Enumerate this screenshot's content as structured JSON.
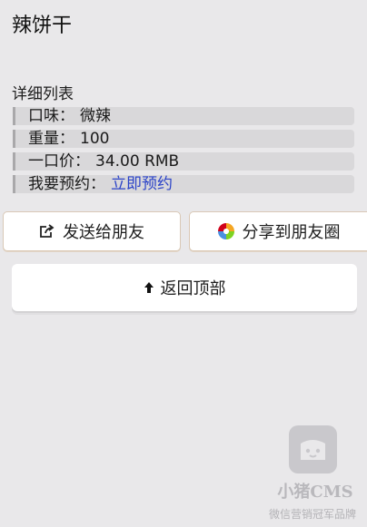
{
  "header": {
    "title": "辣饼干"
  },
  "details": {
    "section_title": "详细列表",
    "rows": [
      {
        "label": "口味：",
        "value": "微辣"
      },
      {
        "label": "重量：",
        "value": "100"
      },
      {
        "label": "一口价：",
        "value": "34.00 RMB"
      },
      {
        "label": "我要预约：",
        "value": "立即预约"
      }
    ]
  },
  "actions": {
    "send_friend_label": "发送给朋友",
    "share_moments_label": "分享到朋友圈",
    "back_to_top_label": "返回顶部"
  },
  "watermark": {
    "logo_icon": "pig-logo-icon",
    "name": "小猪CMS",
    "tagline": "微信营销冠军品牌"
  },
  "colors": {
    "background": "#e9e8ea",
    "link": "#2b43c8",
    "row_background": "#d9d8da"
  }
}
